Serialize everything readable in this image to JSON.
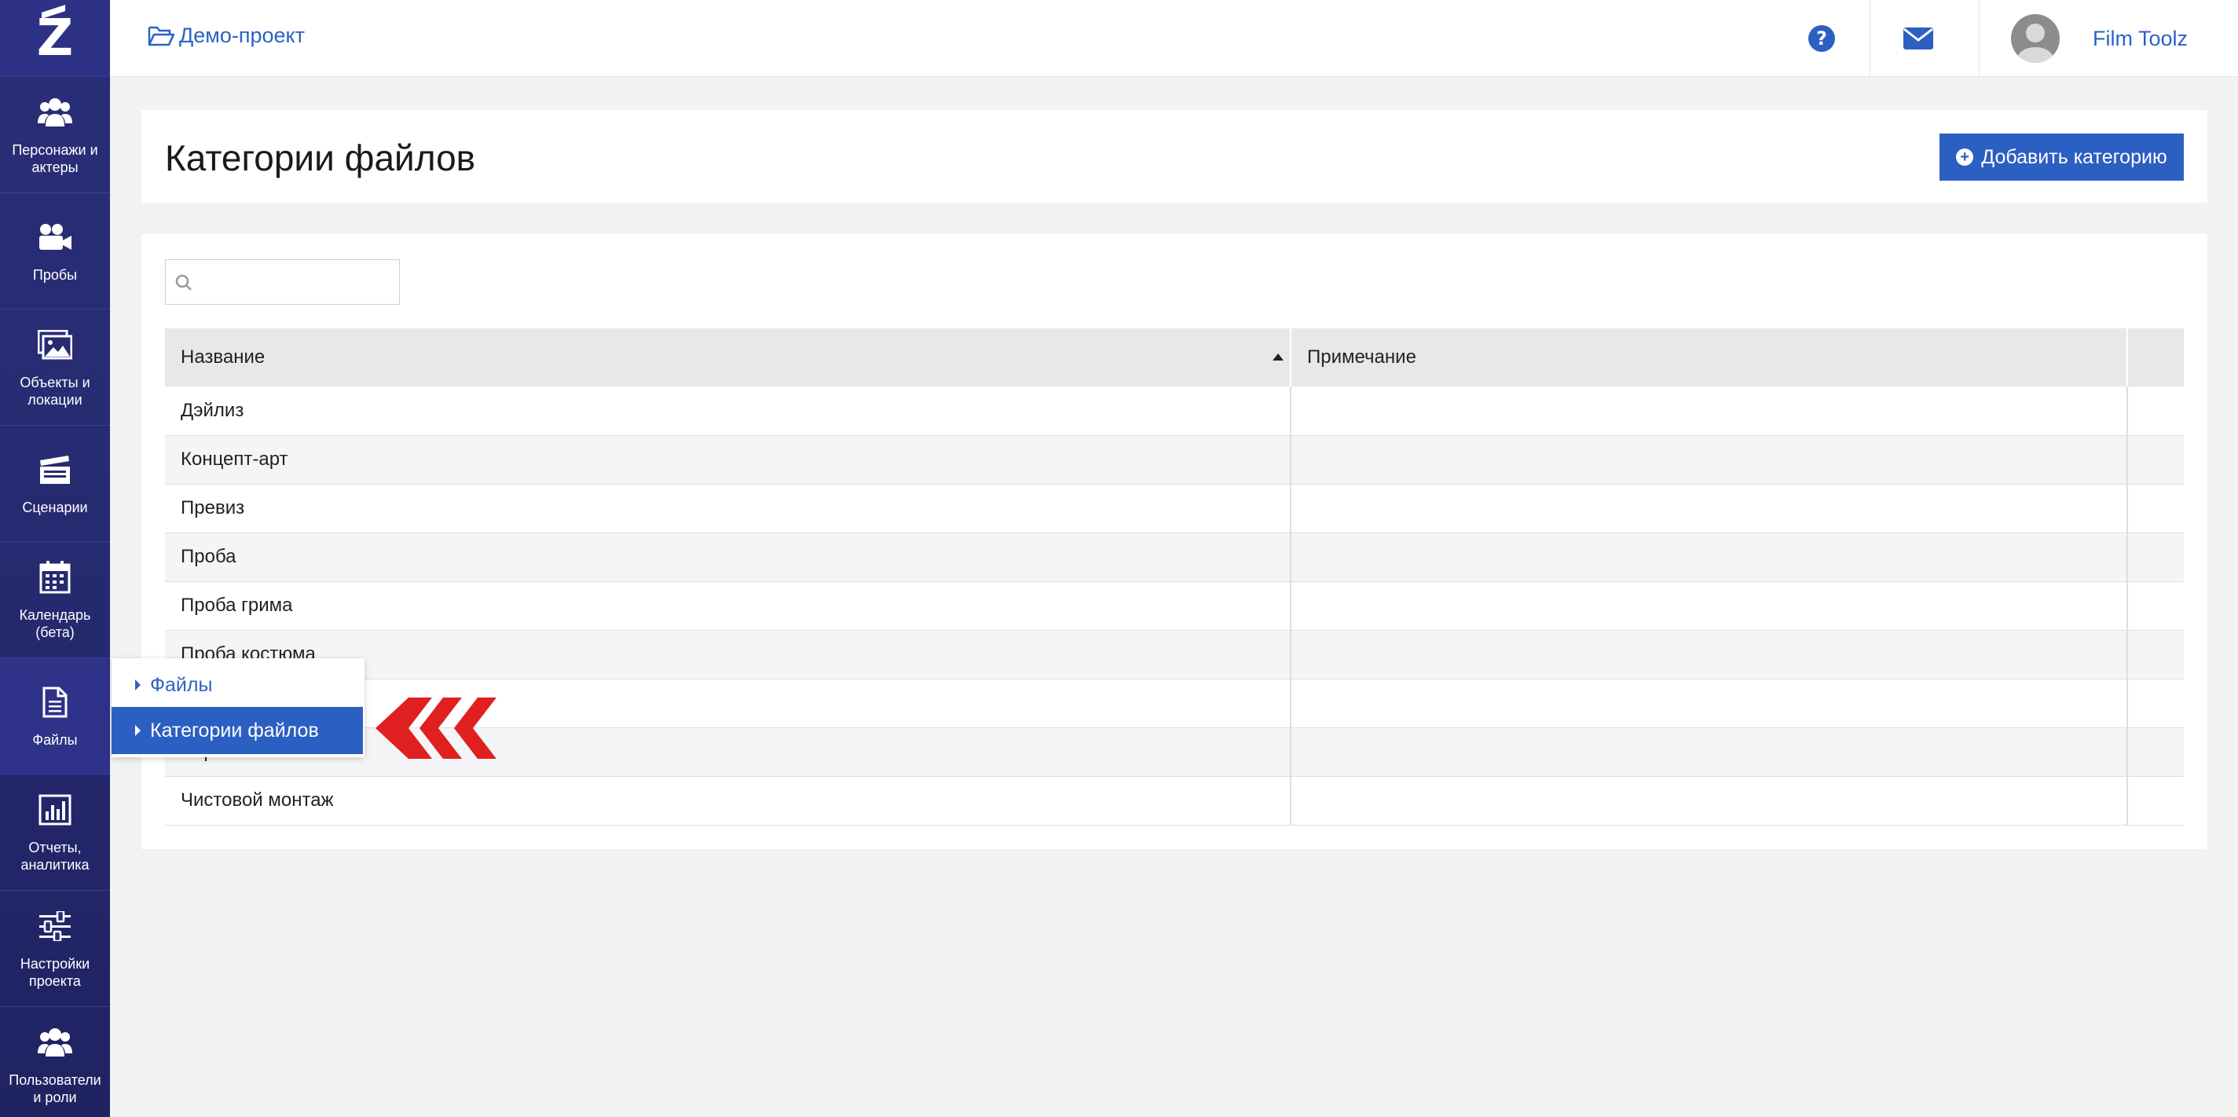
{
  "sidebar": {
    "items": [
      {
        "label": "Персонажи и актеры",
        "icon": "users-icon"
      },
      {
        "label": "Пробы",
        "icon": "video-camera-icon"
      },
      {
        "label": "Объекты и локации",
        "icon": "image-icon"
      },
      {
        "label": "Сценарии",
        "icon": "clapperboard-icon"
      },
      {
        "label": "Календарь (бета)",
        "icon": "calendar-icon"
      },
      {
        "label": "Файлы",
        "icon": "file-icon"
      },
      {
        "label": "Отчеты, аналитика",
        "icon": "bar-chart-icon"
      },
      {
        "label": "Настройки проекта",
        "icon": "sliders-icon"
      },
      {
        "label": "Пользователи и роли",
        "icon": "users-icon"
      }
    ]
  },
  "topbar": {
    "project_name": "Демо-проект",
    "user_name": "Film Toolz"
  },
  "header": {
    "title": "Категории файлов",
    "add_button": "Добавить категорию"
  },
  "search": {
    "value": ""
  },
  "table": {
    "columns": [
      "Название",
      "Примечание"
    ],
    "rows": [
      "Дэйлиз",
      "Концепт-арт",
      "Превиз",
      "Проба",
      "Проба грима",
      "Проба костюма",
      "",
      "Черновой монтаж",
      "Чистовой монтаж"
    ]
  },
  "popup": {
    "items": [
      "Файлы",
      "Категории файлов"
    ]
  },
  "colors": {
    "sidebar": "#272b72",
    "accent": "#2c5fc2",
    "link": "#2b63c4",
    "arrow": "#e02020"
  }
}
